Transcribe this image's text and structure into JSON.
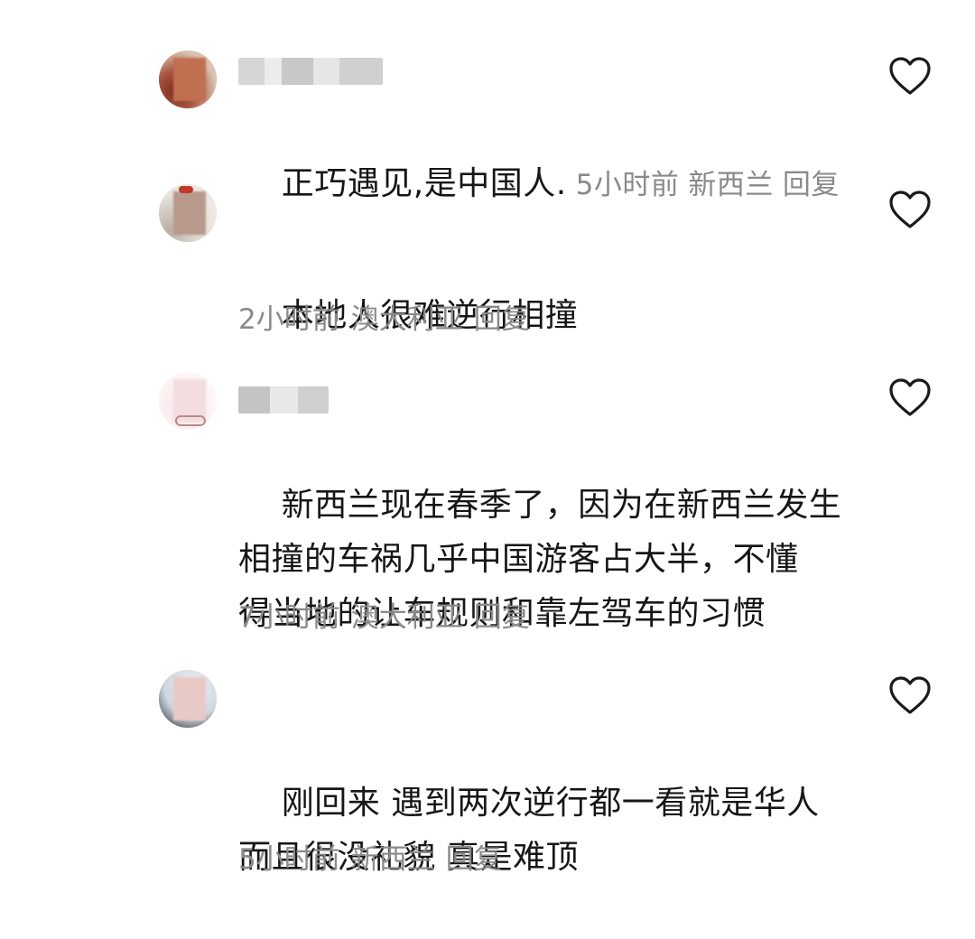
{
  "comments": [
    {
      "text": "正巧遇见,是中国人.",
      "time": "5小时前",
      "location": "新西兰",
      "reply_label": "回复"
    },
    {
      "text": "本地人很难逆行相撞",
      "time": "2小时前",
      "location": "澳大利亚",
      "reply_label": "回复"
    },
    {
      "text": "新西兰现在春季了，因为在新西兰发生\n相撞的车祸几乎中国游客占大半，不懂\n得当地的让车规则和靠左驾车的习惯",
      "time": "7小时前",
      "location": "澳大利亚",
      "reply_label": "回复"
    },
    {
      "text": "刚回来 遇到两次逆行都一看就是华人\n而且很没礼貌 真是难顶",
      "time": "5小时前",
      "location": "新西兰",
      "reply_label": "回复"
    }
  ],
  "icons": {
    "like": "heart-outline-icon"
  },
  "colors": {
    "text": "#161616",
    "meta": "#8a8a8a"
  }
}
